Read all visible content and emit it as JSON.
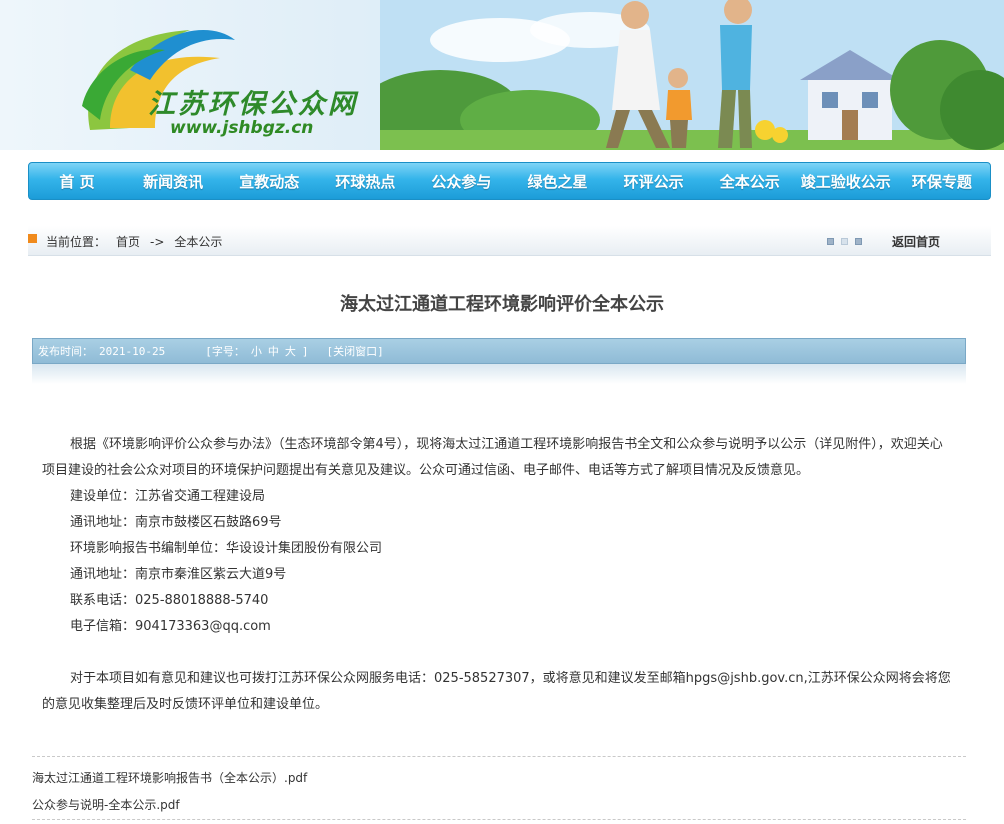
{
  "site": {
    "name": "江苏环保公众网",
    "url": "www.jshbgz.cn"
  },
  "nav": {
    "items": [
      "首 页",
      "新闻资讯",
      "宣教动态",
      "环球热点",
      "公众参与",
      "绿色之星",
      "环评公示",
      "全本公示",
      "竣工验收公示",
      "环保专题"
    ]
  },
  "breadcrumb": {
    "label": "当前位置：",
    "home": "首页",
    "separator": "->",
    "current": "全本公示",
    "back_home": "返回首页"
  },
  "article": {
    "title": "海太过江通道工程环境影响评价全本公示",
    "meta": {
      "publish_label": "发布时间：",
      "publish_date": "2021-10-25",
      "font_size_label": "[字号：",
      "size_small": "小",
      "size_medium": "中",
      "size_large": "大",
      "font_size_end": "]",
      "close_window": "[关闭窗口]"
    },
    "intro": "根据《环境影响评价公众参与办法》（生态环境部令第4号），现将海太过江通道工程环境影响报告书全文和公众参与说明予以公示（详见附件），欢迎关心项目建设的社会公众对项目的环境保护问题提出有关意见及建议。公众可通过信函、电子邮件、电话等方式了解项目情况及反馈意见。",
    "lines": [
      "建设单位：江苏省交通工程建设局",
      "通讯地址：南京市鼓楼区石鼓路69号",
      "环境影响报告书编制单位：华设设计集团股份有限公司",
      "通讯地址：南京市秦淮区紫云大道9号",
      "联系电话：025-88018888-5740",
      "电子信箱：904173363@qq.com"
    ],
    "closing": "对于本项目如有意见和建议也可拨打江苏环保公众网服务电话：025-58527307，或将意见和建议发至邮箱hpgs@jshb.gov.cn,江苏环保公众网将会将您的意见收集整理后及时反馈环评单位和建设单位。"
  },
  "attachments": [
    "海太过江通道工程环境影响报告书（全本公示）.pdf",
    "公众参与说明-全本公示.pdf"
  ],
  "colors": {
    "nav_blue": "#1c9cd8",
    "crumb_marker": "#f08a1c",
    "logo_green": "#2e8a2a"
  }
}
